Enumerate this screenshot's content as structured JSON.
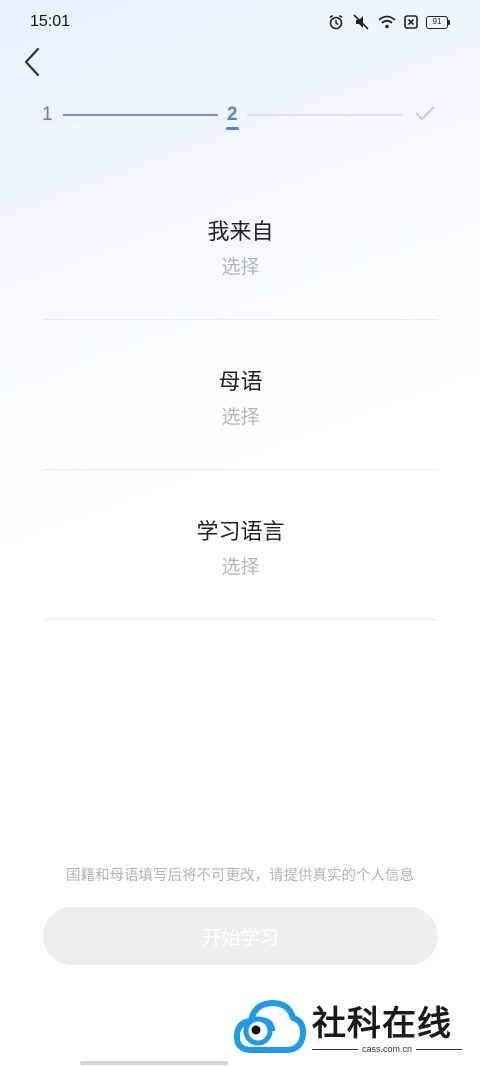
{
  "status_bar": {
    "time": "15:01",
    "battery": "91",
    "icons": [
      "alarm-icon",
      "mute-icon",
      "wifi-icon",
      "sim-off-icon",
      "battery-icon"
    ]
  },
  "nav": {
    "back_icon": "chevron-left-icon"
  },
  "stepper": {
    "step1": "1",
    "step2": "2",
    "final_icon": "check-icon",
    "current_step": 2,
    "active_color": "#5b7fd6"
  },
  "sections": [
    {
      "title": "我来自",
      "value": "选择"
    },
    {
      "title": "母语",
      "value": "选择"
    },
    {
      "title": "学习语言",
      "value": "选择"
    }
  ],
  "notice": "国籍和母语填写后将不可更改，请提供真实的个人信息",
  "start_button": {
    "label": "开始学习",
    "enabled": false
  },
  "watermark": {
    "name": "社科在线",
    "url": "cass.com.cn",
    "brand_color": "#1e9be8"
  }
}
